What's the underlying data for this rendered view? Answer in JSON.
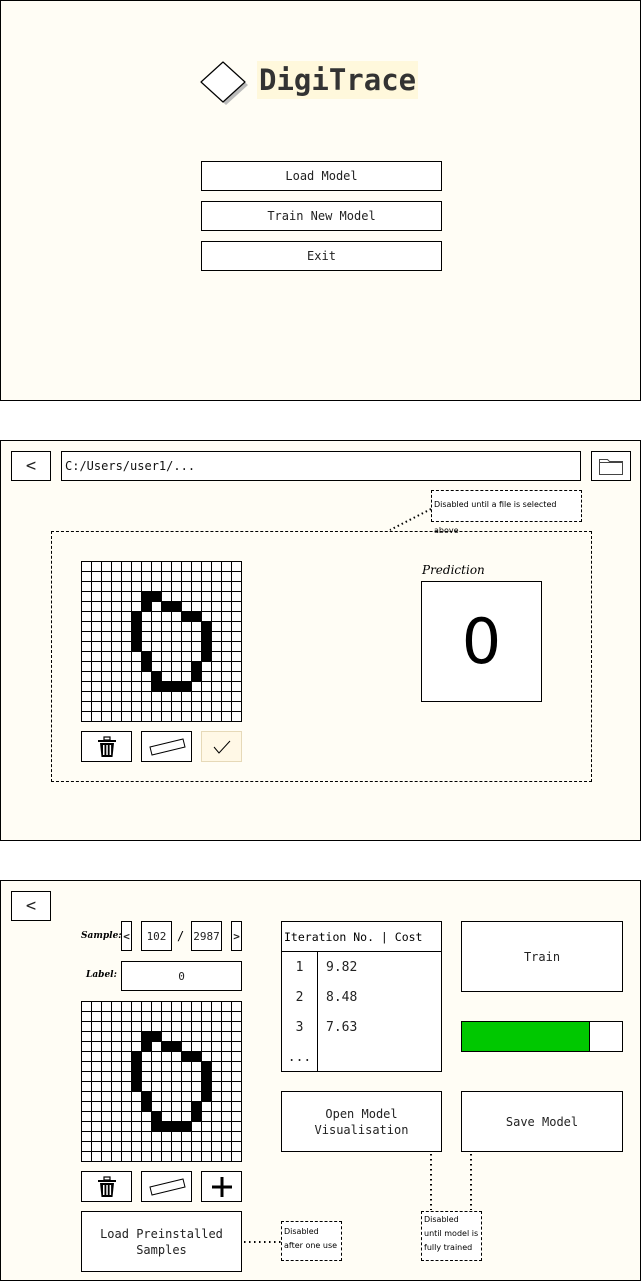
{
  "menu": {
    "app_title": "DigiTrace",
    "load_model_label": "Load Model",
    "train_new_model_label": "Train New Model",
    "exit_label": "Exit"
  },
  "predict": {
    "back_label": "<",
    "path_value": "C:/Users/user1/...",
    "disabled_note": "Disabled until a file is selected above",
    "prediction_heading": "Prediction",
    "prediction_value": "0"
  },
  "train": {
    "back_label": "<",
    "sample_label": "Sample:",
    "prev_label": "<",
    "next_label": ">",
    "sample_index": "102",
    "sample_separator": "/",
    "sample_total": "2987",
    "label_label": "Label:",
    "label_value": "0",
    "table_header": "Iteration No. | Cost",
    "rows": [
      {
        "iter": "1",
        "cost": "9.82"
      },
      {
        "iter": "2",
        "cost": "8.48"
      },
      {
        "iter": "3",
        "cost": "7.63"
      }
    ],
    "ellipsis": "...",
    "train_label": "Train",
    "progress": 0.8,
    "progress_color": "#00c800",
    "open_vis_label": "Open Model Visualisation",
    "save_model_label": "Save Model",
    "load_preinstalled_label": "Load Preinstalled Samples",
    "note_after_one_use": "Disabled after one use",
    "note_until_trained": "Disabled until model is fully trained"
  },
  "icons": {
    "logo": "diamond-logo-icon",
    "folder": "folder-icon",
    "trash": "trash-icon",
    "eraser": "eraser-icon",
    "check": "check-icon",
    "plus": "plus-icon"
  },
  "digit_grid": {
    "size": 16,
    "filled": [
      [
        3,
        6
      ],
      [
        3,
        7
      ],
      [
        4,
        6
      ],
      [
        4,
        8
      ],
      [
        4,
        9
      ],
      [
        5,
        5
      ],
      [
        5,
        10
      ],
      [
        5,
        11
      ],
      [
        6,
        5
      ],
      [
        6,
        12
      ],
      [
        7,
        5
      ],
      [
        7,
        12
      ],
      [
        8,
        5
      ],
      [
        8,
        12
      ],
      [
        9,
        6
      ],
      [
        9,
        12
      ],
      [
        10,
        6
      ],
      [
        10,
        11
      ],
      [
        11,
        7
      ],
      [
        11,
        11
      ],
      [
        12,
        7
      ],
      [
        12,
        8
      ],
      [
        12,
        9
      ],
      [
        12,
        10
      ]
    ]
  }
}
